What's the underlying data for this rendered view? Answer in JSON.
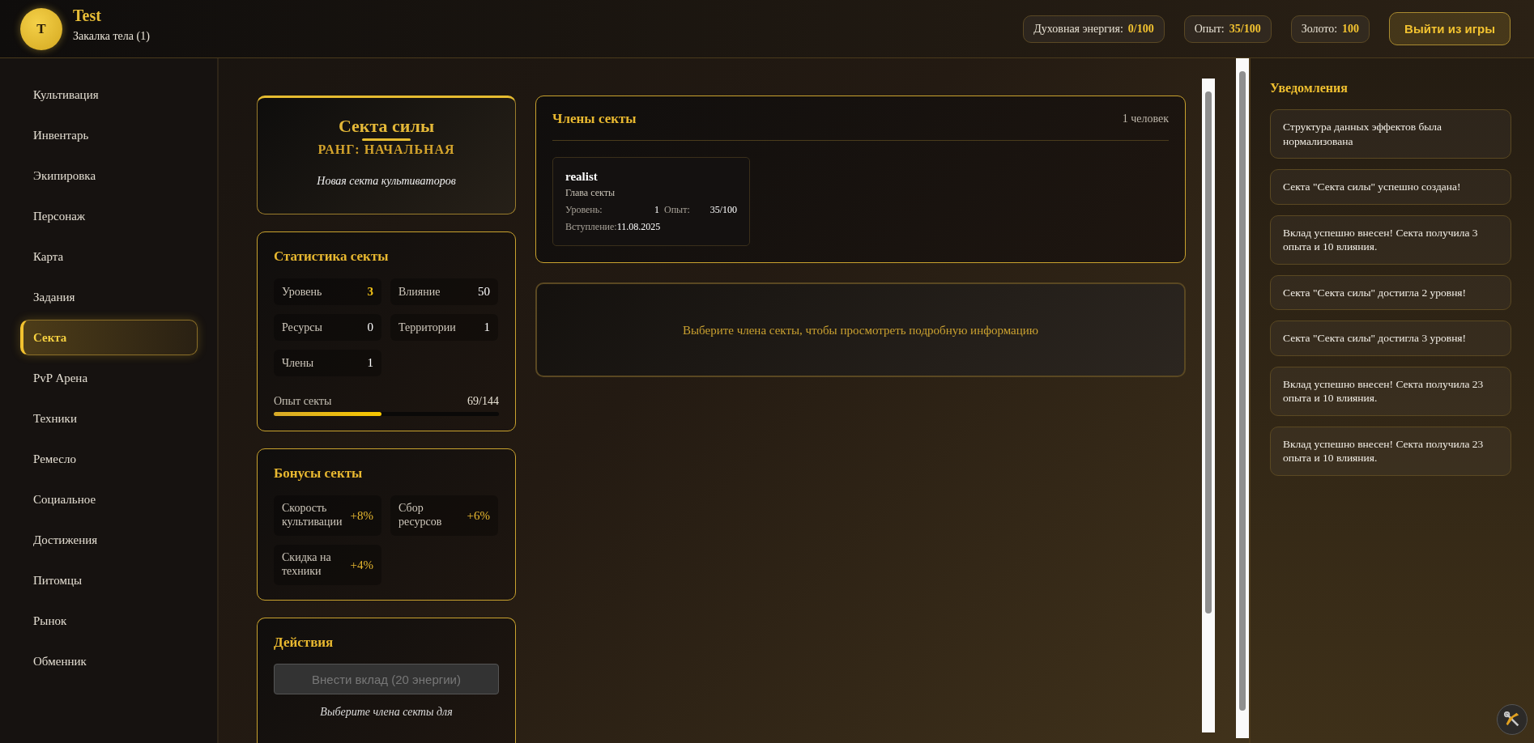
{
  "header": {
    "avatar_letter": "T",
    "player_name": "Test",
    "realm": "Закалка тела (1)",
    "stats": [
      {
        "label": "Духовная энергия:",
        "value": "0/100"
      },
      {
        "label": "Опыт:",
        "value": "35/100"
      },
      {
        "label": "Золото:",
        "value": "100"
      }
    ],
    "logout_button": "Выйти из игры"
  },
  "sidebar": {
    "items": [
      {
        "label": "Культивация",
        "selected": false
      },
      {
        "label": "Инвентарь",
        "selected": false
      },
      {
        "label": "Экипировка",
        "selected": false
      },
      {
        "label": "Персонаж",
        "selected": false
      },
      {
        "label": "Карта",
        "selected": false
      },
      {
        "label": "Задания",
        "selected": false
      },
      {
        "label": "Секта",
        "selected": true
      },
      {
        "label": "PvP Арена",
        "selected": false
      },
      {
        "label": "Техники",
        "selected": false
      },
      {
        "label": "Ремесло",
        "selected": false
      },
      {
        "label": "Социальное",
        "selected": false
      },
      {
        "label": "Достижения",
        "selected": false
      },
      {
        "label": "Питомцы",
        "selected": false
      },
      {
        "label": "Рынок",
        "selected": false
      },
      {
        "label": "Обменник",
        "selected": false
      }
    ]
  },
  "sect_card": {
    "name": "Секта силы",
    "rank": "РАНГ: НАЧАЛЬНАЯ",
    "description": "Новая секта культиваторов"
  },
  "stats_card": {
    "title": "Статистика секты",
    "stats": [
      {
        "label": "Уровень",
        "value": "3",
        "highlight": true
      },
      {
        "label": "Влияние",
        "value": "50",
        "highlight": false
      },
      {
        "label": "Ресурсы",
        "value": "0",
        "highlight": false
      },
      {
        "label": "Территории",
        "value": "1",
        "highlight": false
      },
      {
        "label": "Члены",
        "value": "1",
        "highlight": false
      }
    ],
    "experience": {
      "label": "Опыт секты",
      "reading": "69/144",
      "level": 0.479
    }
  },
  "bonuses_card": {
    "title": "Бонусы секты",
    "bonuses": [
      {
        "label": "Скорость культивации",
        "value": "+8%"
      },
      {
        "label": "Сбор ресурсов",
        "value": "+6%"
      },
      {
        "label": "Скидка на техники",
        "value": "+4%"
      }
    ]
  },
  "actions_card": {
    "title": "Действия",
    "contribute_button": {
      "label": "Внести вклад (20 энергии)",
      "disabled": true
    },
    "hint": "Выберите члена секты для"
  },
  "members_card": {
    "title": "Члены секты",
    "count": "1 человек",
    "members": [
      {
        "name": "realist",
        "role": "Глава секты",
        "level_label": "Уровень:",
        "level_value": "1",
        "exp_label": "Опыт:",
        "exp_value": "35/100",
        "joined_label": "Вступление:",
        "joined_value": "11.08.2025",
        "selected": false
      }
    ]
  },
  "member_details": {
    "placeholder": "Выберите члена секты, чтобы просмотреть подробную информацию"
  },
  "notifications": {
    "title": "Уведомления",
    "items": [
      "Структура данных эффектов была нормализована",
      "Секта \"Секта силы\" успешно создана!",
      "Вклад успешно внесен! Секта получила 3 опыта и 10 влияния.",
      "Секта \"Секта силы\" достигла 2 уровня!",
      "Секта \"Секта силы\" достигла 3 уровня!",
      "Вклад успешно внесен! Секта получила 23 опыта и 10 влияния.",
      "Вклад успешно внесен! Секта получила 23 опыта и 10 влияния."
    ]
  }
}
